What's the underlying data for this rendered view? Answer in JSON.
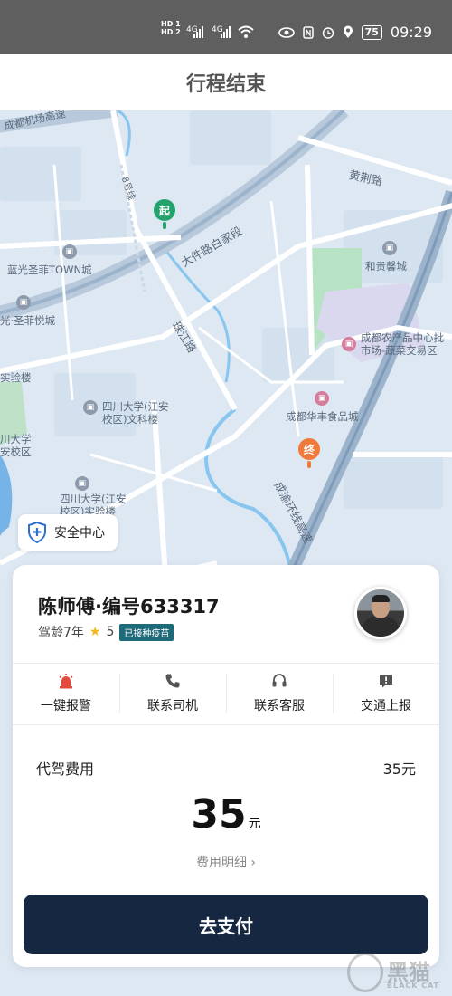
{
  "status_bar": {
    "hd1": "HD 1",
    "hd2": "HD 2",
    "net1": "4G",
    "net2": "4G",
    "battery": "75",
    "time": "09:29"
  },
  "header": {
    "title": "行程结束"
  },
  "map": {
    "roads": {
      "airport_expressway": "成都机场高速",
      "line8": "8号线",
      "dajian": "大件路白家段",
      "zhujiang": "珠江路",
      "huangjing": "黄荆路",
      "chengyu": "成渝环线高速"
    },
    "pois": {
      "languang_town": "蓝光圣菲TOWN城",
      "feiyue": "光·圣菲悦城",
      "shiyanlou": "实验楼",
      "scu_wenke": [
        "四川大学(江安",
        "校区)文科楼"
      ],
      "scu_left": [
        "川大学",
        "安校区"
      ],
      "scu_shiyan": [
        "四川大学(江安",
        "校区)实验楼"
      ],
      "heguixin": "和贵馨城",
      "nongchanpin": [
        "成都农产品中心批",
        "市场-蔬菜交易区"
      ],
      "huafeng": "成都华丰食品城"
    },
    "start_label": "起",
    "end_label": "终"
  },
  "safety": {
    "label": "安全中心"
  },
  "driver": {
    "name": "陈师傅·编号633317",
    "experience": "驾龄7年",
    "rating": "5",
    "vaccine_badge": "已接种疫苗"
  },
  "actions": [
    {
      "label": "一键报警",
      "icon": "alarm-icon"
    },
    {
      "label": "联系司机",
      "icon": "phone-icon"
    },
    {
      "label": "联系客服",
      "icon": "headset-icon"
    },
    {
      "label": "交通上报",
      "icon": "report-icon"
    }
  ],
  "fee": {
    "label": "代驾费用",
    "value": "35元",
    "total": "35",
    "unit": "元",
    "detail_link": "费用明细"
  },
  "pay_button": "去支付",
  "watermark": {
    "cn": "黑猫",
    "en": "BLACK CAT"
  },
  "colors": {
    "start_pin": "#23a36b",
    "end_pin": "#ef7a3a",
    "pay_button": "#162741",
    "vaccine_badge": "#1f6a7a"
  }
}
